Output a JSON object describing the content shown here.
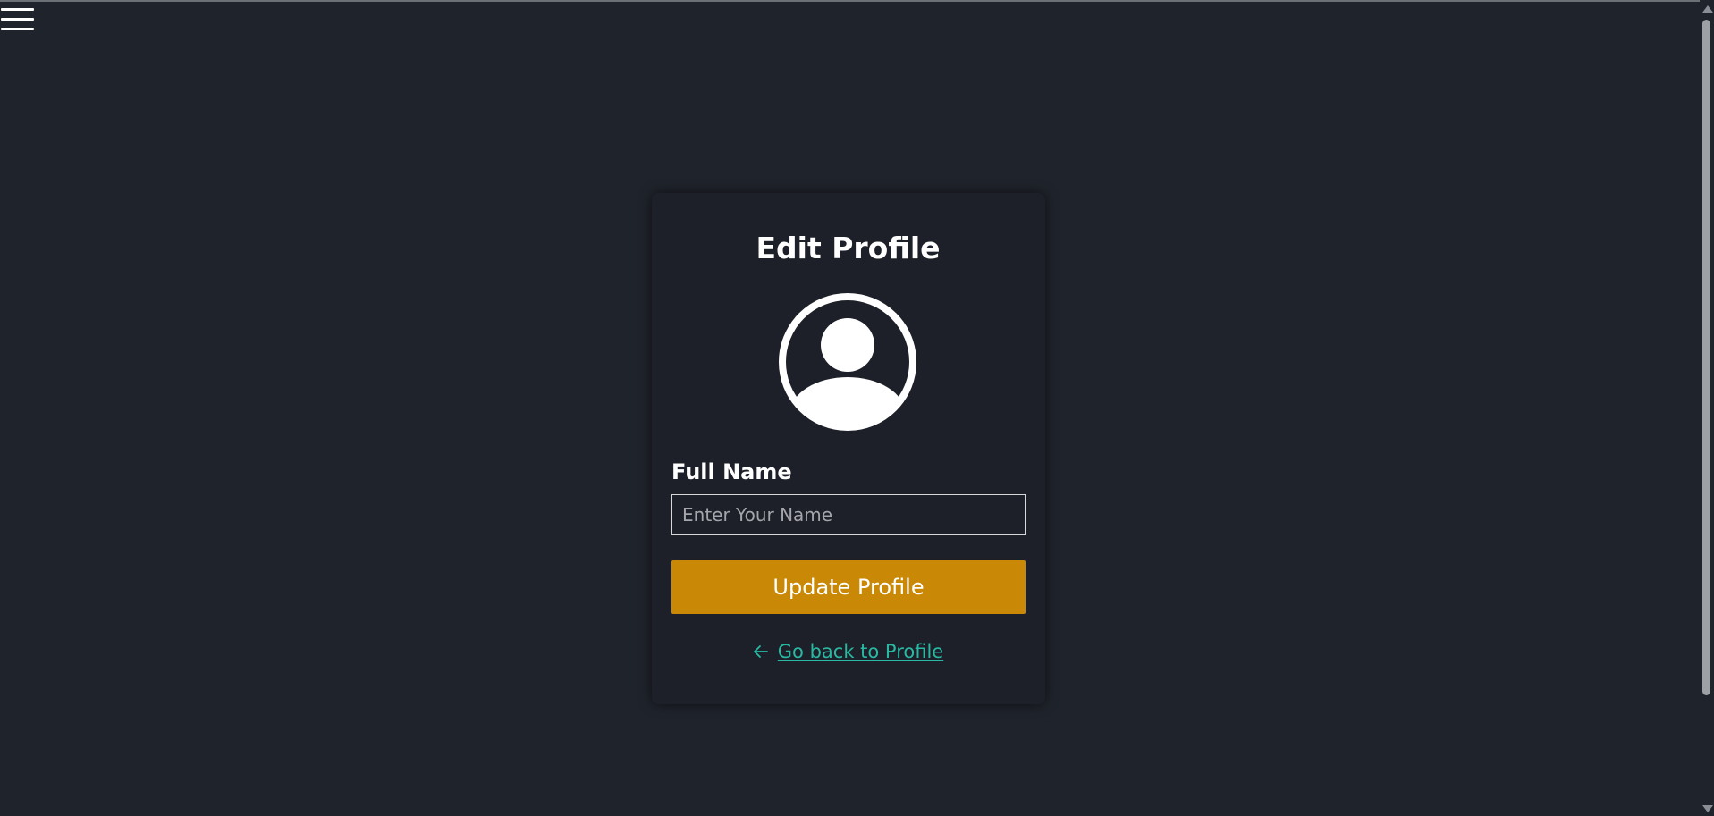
{
  "menu": {
    "icon": "hamburger-menu-icon"
  },
  "card": {
    "title": "Edit Profile",
    "avatar_icon": "user-circle-icon",
    "full_name": {
      "label": "Full Name",
      "placeholder": "Enter Your Name",
      "value": ""
    },
    "update_button_label": "Update Profile",
    "back_link": {
      "arrow_icon": "arrow-left-icon",
      "label": "Go back to Profile"
    }
  },
  "colors": {
    "background": "#1f232b",
    "card": "#1d2028",
    "accent_button": "#c98805",
    "link": "#29b9a3",
    "text": "#ffffff"
  }
}
